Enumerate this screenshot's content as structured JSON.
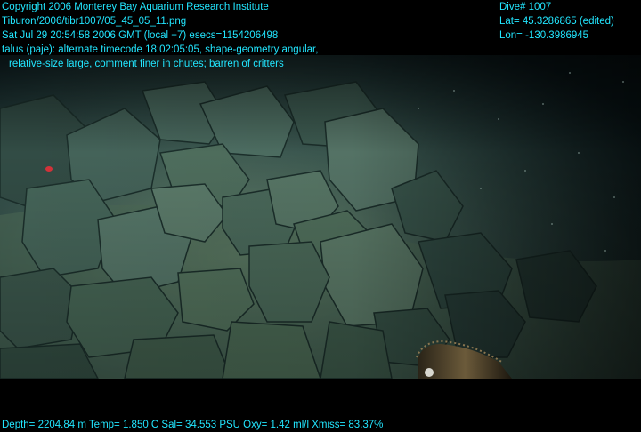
{
  "header_left": {
    "line1": "Copyright 2006 Monterey Bay Aquarium Research Institute",
    "line2": "Tiburon/2006/tibr1007/05_45_05_11.png",
    "line3": "Sat Jul 29 20:54:58 2006 GMT (local +7)  esecs=1154206498",
    "line4": "talus (paje): alternate timecode 18:02:05:05, shape-geometry angular,",
    "line5": "relative-size large, comment finer in chutes; barren of critters"
  },
  "header_right": {
    "dive": "Dive# 1007",
    "lat": "Lat= 45.3286865 (edited)",
    "lon": "Lon= -130.3986945"
  },
  "footer": {
    "telemetry": "Depth= 2204.84 m  Temp= 1.850 C  Sal= 34.553 PSU  Oxy= 1.42 ml/l  Xmiss= 83.37%"
  },
  "colors": {
    "overlay_text": "#22e6ff",
    "water_dark": "#0d1e22",
    "rock_mid": "#4a6a60",
    "sediment": "#5c7a5e"
  }
}
